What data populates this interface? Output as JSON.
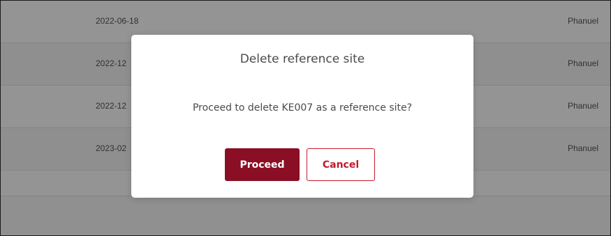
{
  "table": {
    "rows": [
      {
        "date": "2022-06-18",
        "user": "Phanuel"
      },
      {
        "date": "2022-12",
        "user": "Phanuel"
      },
      {
        "date": "2022-12",
        "user": "Phanuel"
      },
      {
        "date": "2023-02",
        "user": "Phanuel"
      }
    ]
  },
  "modal": {
    "title": "Delete reference site",
    "message": "Proceed to delete KE007 as a reference site?",
    "proceed_label": "Proceed",
    "cancel_label": "Cancel"
  },
  "colors": {
    "proceed_bg": "#8b0f24",
    "cancel_accent": "#c41a2b",
    "backdrop": "rgba(0,0,0,0.42)"
  }
}
